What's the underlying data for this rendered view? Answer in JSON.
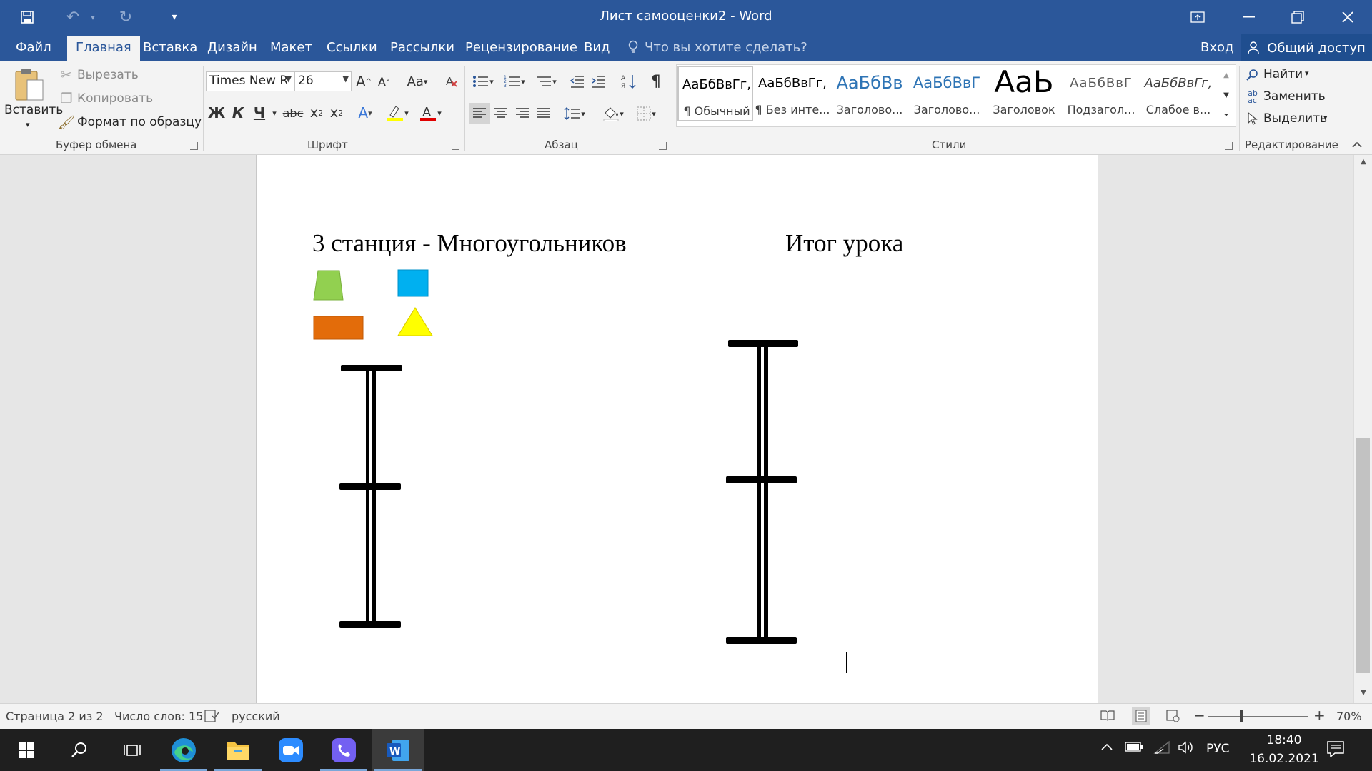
{
  "window": {
    "title": "Лист самооценки2 - Word"
  },
  "quick_access": {
    "icons": [
      "save-icon",
      "undo-icon",
      "redo-icon",
      "customize-icon"
    ]
  },
  "tabs": [
    {
      "label": "Файл"
    },
    {
      "label": "Главная",
      "active": true
    },
    {
      "label": "Вставка"
    },
    {
      "label": "Дизайн"
    },
    {
      "label": "Макет"
    },
    {
      "label": "Ссылки"
    },
    {
      "label": "Рассылки"
    },
    {
      "label": "Рецензирование"
    },
    {
      "label": "Вид"
    }
  ],
  "tellme": {
    "placeholder": "Что вы хотите сделать?"
  },
  "signin": "Вход",
  "share": "Общий доступ",
  "clipboard": {
    "paste": "Вставить",
    "cut": "Вырезать",
    "copy": "Копировать",
    "format_painter": "Формат по образцу",
    "group_label": "Буфер обмена"
  },
  "font": {
    "family": "Times New R",
    "size": "26",
    "group_label": "Шрифт",
    "bold": "Ж",
    "italic": "К",
    "underline": "Ч",
    "strike": "abc",
    "case": "Aa"
  },
  "paragraph": {
    "group_label": "Абзац"
  },
  "styles": {
    "group_label": "Стили",
    "items": [
      {
        "sample": "АаБбВвГг,",
        "name": "¶ Обычный"
      },
      {
        "sample": "АаБбВвГг,",
        "name": "¶ Без инте..."
      },
      {
        "sample": "АаБбВв",
        "name": "Заголово..."
      },
      {
        "sample": "АаБбВвГ",
        "name": "Заголово..."
      },
      {
        "sample": "АаЬ",
        "name": "Заголовок"
      },
      {
        "sample": "АаБбВвГ",
        "name": "Подзагол..."
      },
      {
        "sample": "АаБбВвГг,",
        "name": "Слабое в..."
      }
    ]
  },
  "editing": {
    "find": "Найти",
    "replace": "Заменить",
    "select": "Выделить",
    "group_label": "Редактирование"
  },
  "document": {
    "heading_left": "3 станция - Многоугольников",
    "heading_right": "Итог урока"
  },
  "colors": {
    "trapezoid": "#92d050",
    "square": "#00b0f0",
    "rectangle": "#e36c0a",
    "triangle": "#ffff00",
    "word_blue": "#2b579a"
  },
  "status": {
    "page": "Страница 2 из 2",
    "words": "Число слов: 15",
    "language": "русский",
    "zoom": "70%",
    "zoom_value": 70
  },
  "taskbar": {
    "apps": [
      "windows-start-icon",
      "search-icon",
      "task-view-icon",
      "edge-icon",
      "file-explorer-icon",
      "zoom-icon",
      "viber-icon",
      "word-icon"
    ],
    "language": "РУС",
    "time": "18:40",
    "date": "16.02.2021"
  }
}
